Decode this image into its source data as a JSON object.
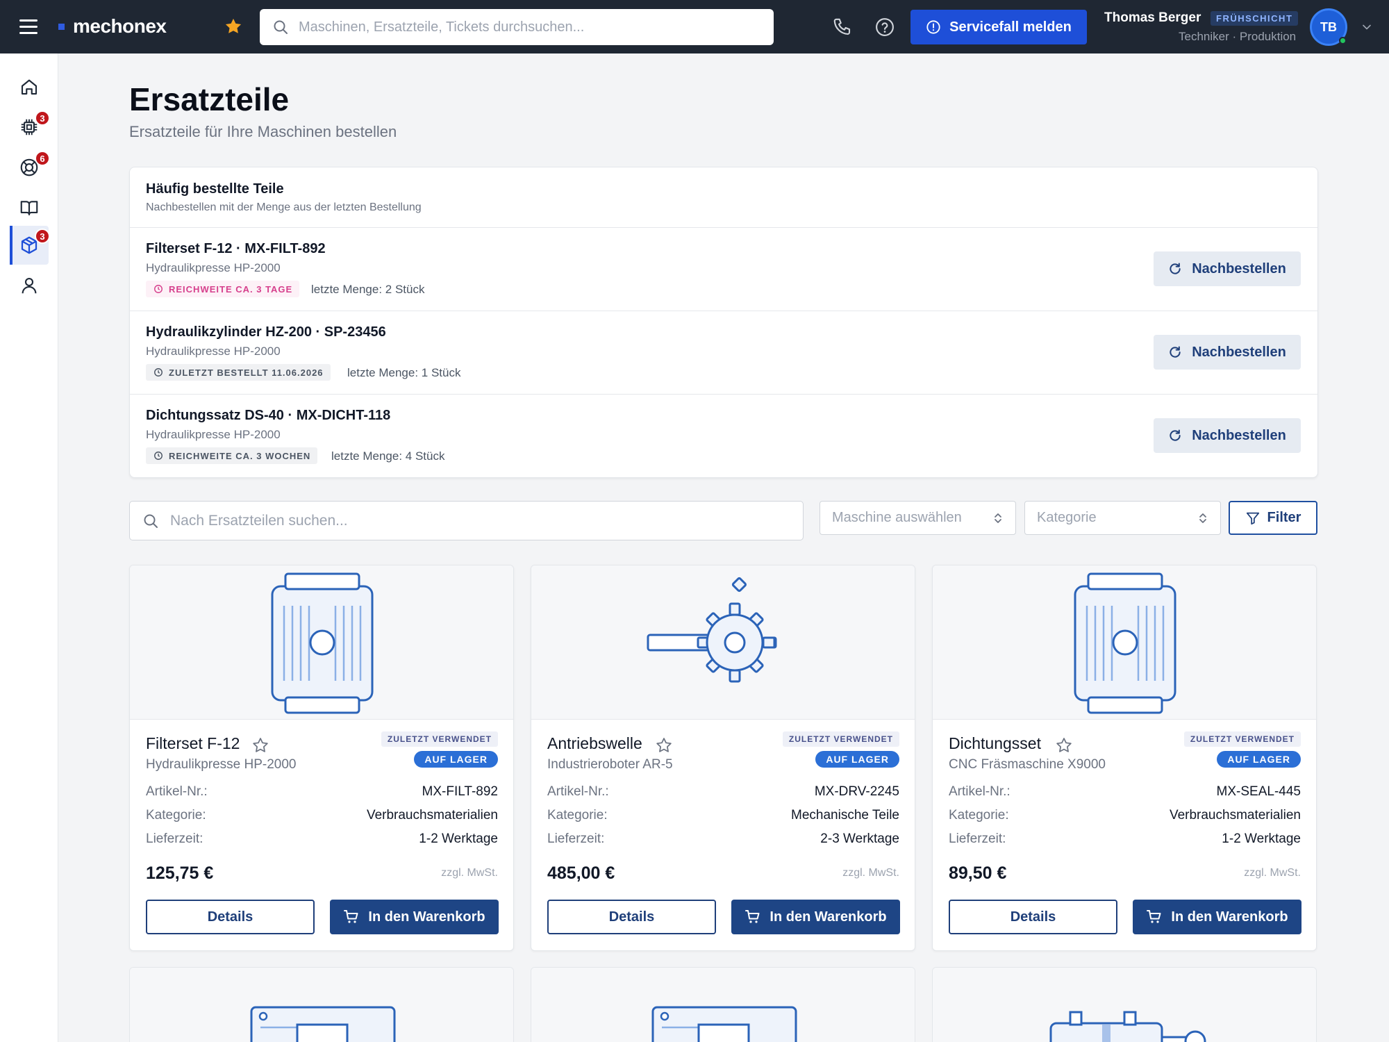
{
  "topbar": {
    "brand": "mechonex",
    "search_placeholder": "Maschinen, Ersatzteile, Tickets durchsuchen...",
    "service_button": "Servicefall melden",
    "user_name": "Thomas Berger",
    "shift": "FRÜHSCHICHT",
    "user_role": "Techniker · Produktion",
    "avatar_initials": "TB"
  },
  "sidebar": {
    "items": [
      {
        "name": "home-icon",
        "badge": ""
      },
      {
        "name": "chip-icon",
        "badge": "3"
      },
      {
        "name": "lifebuoy-icon",
        "badge": "6"
      },
      {
        "name": "book-icon",
        "badge": ""
      },
      {
        "name": "package-icon",
        "badge": "3",
        "active": true
      },
      {
        "name": "user-icon",
        "badge": ""
      }
    ]
  },
  "page": {
    "title": "Ersatzteile",
    "subtitle": "Ersatzteile für Ihre Maschinen bestellen"
  },
  "frequent": {
    "title": "Häufig bestellte Teile",
    "subtitle": "Nachbestellen mit der Menge aus der letzten Bestellung",
    "reorder_label": "Nachbestellen",
    "items": [
      {
        "name": "Filterset F-12 · MX-FILT-892",
        "machine": "Hydraulikpresse HP-2000",
        "tag": "REICHWEITE CA. 3 TAGE",
        "qty": "letzte Menge: 2 Stück"
      },
      {
        "name": "Hydraulikzylinder HZ-200 · SP-23456",
        "machine": "Hydraulikpresse HP-2000",
        "tag": "ZULETZT BESTELLT 11.06.2026",
        "qty": "letzte Menge: 1 Stück"
      },
      {
        "name": "Dichtungssatz DS-40 · MX-DICHT-118",
        "machine": "Hydraulikpresse HP-2000",
        "tag": "REICHWEITE CA. 3 WOCHEN",
        "qty": "letzte Menge: 4 Stück"
      }
    ]
  },
  "filters": {
    "search_placeholder": "Nach Ersatzteilen suchen...",
    "machine_placeholder": "Maschine auswählen",
    "category_placeholder": "Kategorie",
    "filter_button": "Filter"
  },
  "card_labels": {
    "article": "Artikel-Nr.:",
    "category": "Kategorie:",
    "delivery": "Lieferzeit:",
    "vat": "zzgl. MwSt.",
    "details": "Details",
    "cart": "In den Warenkorb",
    "recent": "ZULETZT VERWENDET",
    "stock": "AUF LAGER"
  },
  "cards": [
    {
      "name": "Filterset F-12",
      "machine": "Hydraulikpresse HP-2000",
      "article": "MX-FILT-892",
      "category": "Verbrauchsmaterialien",
      "delivery": "1-2 Werktage",
      "price": "125,75 €"
    },
    {
      "name": "Antriebswelle",
      "machine": "Industrieroboter AR-5",
      "article": "MX-DRV-2245",
      "category": "Mechanische Teile",
      "delivery": "2-3 Werktage",
      "price": "485,00 €"
    },
    {
      "name": "Dichtungsset",
      "machine": "CNC Fräsmaschine X9000",
      "article": "MX-SEAL-445",
      "category": "Verbrauchsmaterialien",
      "delivery": "1-2 Werktage",
      "price": "89,50 €"
    }
  ],
  "colors": {
    "topbar": "#1f2733",
    "accent": "#1e4fd8",
    "primary_button": "#1e4585",
    "badge": "#c0161b",
    "stock": "#2b6fd6"
  }
}
